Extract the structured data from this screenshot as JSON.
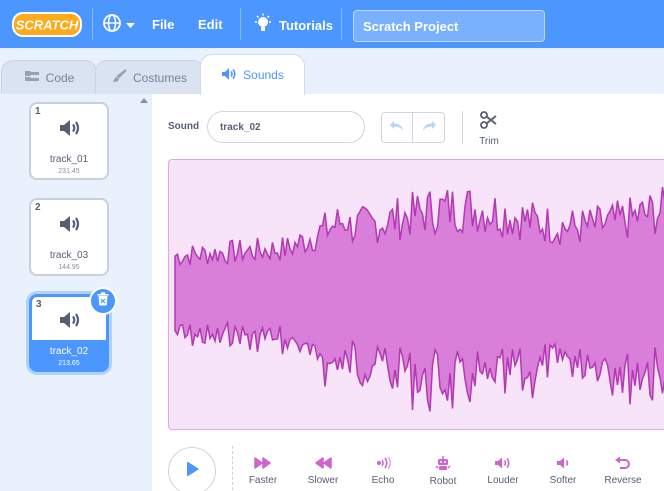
{
  "app": {
    "logo_text": "SCRATCH",
    "menu": {
      "file": "File",
      "edit": "Edit",
      "tutorials": "Tutorials"
    },
    "project_title": "Scratch Project"
  },
  "tabs": [
    {
      "label": "Code",
      "icon": "code-icon"
    },
    {
      "label": "Costumes",
      "icon": "brush-icon"
    },
    {
      "label": "Sounds",
      "icon": "speaker-icon",
      "active": true
    }
  ],
  "sounds": [
    {
      "number": "1",
      "name": "track_01",
      "duration": "231.45"
    },
    {
      "number": "2",
      "name": "track_03",
      "duration": "144.95"
    },
    {
      "number": "3",
      "name": "track_02",
      "duration": "213.65",
      "selected": true
    }
  ],
  "editor": {
    "sound_label": "Sound",
    "sound_name_value": "track_02",
    "trim_label": "Trim",
    "effects": [
      "Faster",
      "Slower",
      "Echo",
      "Robot",
      "Louder",
      "Softer",
      "Reverse"
    ]
  },
  "colors": {
    "menubar": "#4c97ff",
    "accent": "#4c97ff",
    "waveform_fill": "#d97fd9",
    "waveform_stroke": "#b338b3",
    "effect_icon": "#cf63cf"
  }
}
